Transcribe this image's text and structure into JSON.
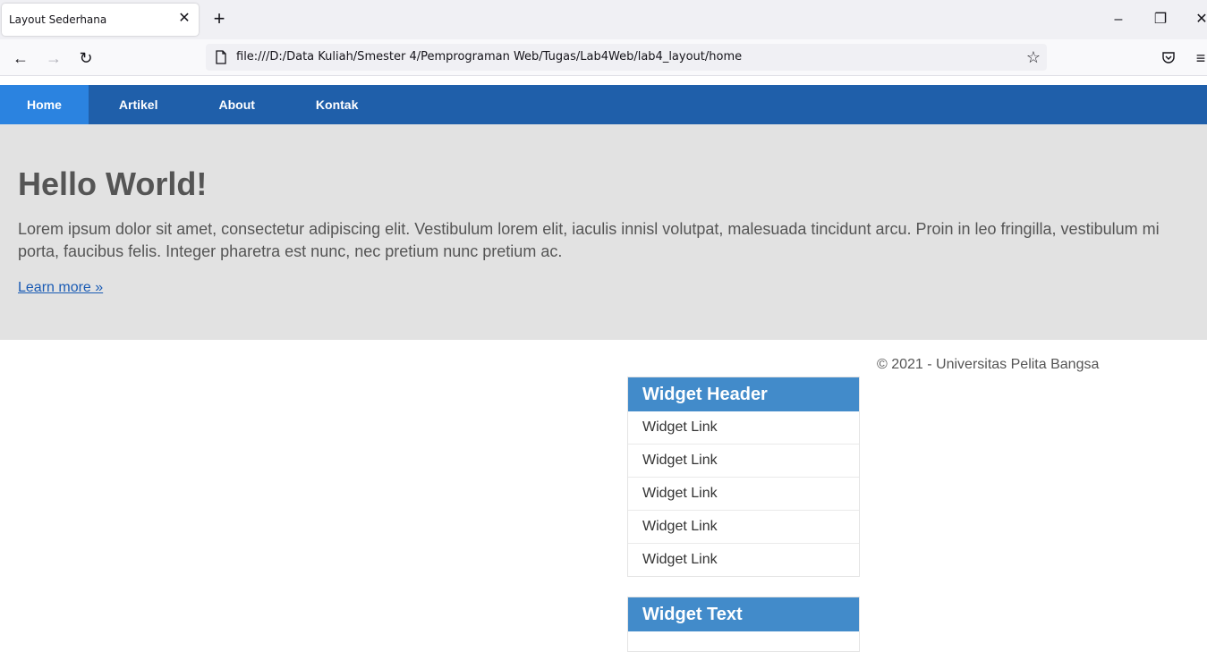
{
  "browser": {
    "tab_title": "Layout Sederhana",
    "tab_close_icon": "close-icon",
    "new_tab_icon": "plus-icon",
    "url": "file:///D:/Data Kuliah/Smester 4/Pemprograman Web/Tugas/Lab4Web/lab4_layout/home"
  },
  "nav": {
    "items": [
      {
        "label": "Home",
        "active": true
      },
      {
        "label": "Artikel",
        "active": false
      },
      {
        "label": "About",
        "active": false
      },
      {
        "label": "Kontak",
        "active": false
      }
    ]
  },
  "hero": {
    "title": "Hello World!",
    "body": "Lorem ipsum dolor sit amet, consectetur adipiscing elit. Vestibulum lorem elit, iaculis innisl volutpat, malesuada tincidunt arcu. Proin in leo fringilla, vestibulum mi porta, faucibus felis. Integer pharetra est nunc, nec pretium nunc pretium ac.",
    "link": "Learn more »"
  },
  "widgets": {
    "links_header": "Widget Header",
    "links": [
      "Widget Link",
      "Widget Link",
      "Widget Link",
      "Widget Link",
      "Widget Link"
    ],
    "text_header": "Widget Text"
  },
  "footer": {
    "copyright": "© 2021 - Universitas Pelita Bangsa"
  },
  "colors": {
    "nav_bg": "#1f5faa",
    "nav_active": "#2b83e0",
    "hero_bg": "#e2e2e2",
    "widget_header": "#428bca"
  }
}
